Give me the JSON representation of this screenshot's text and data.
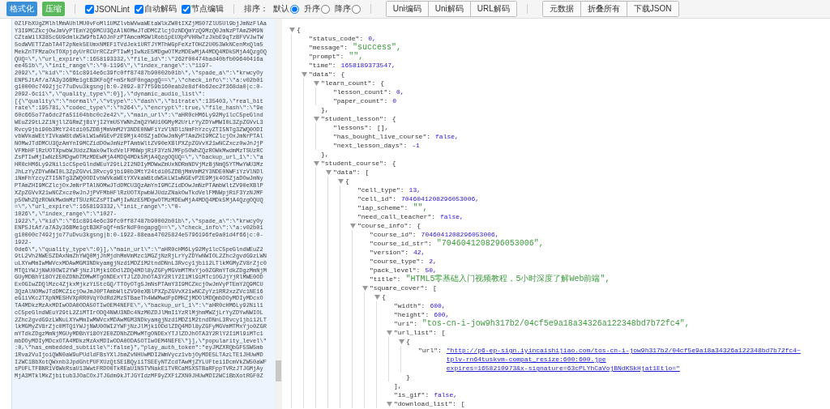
{
  "toolbar": {
    "primary_buttons": [
      {
        "label": "格式化",
        "kind": "blue"
      },
      {
        "label": "压缩",
        "kind": "green"
      }
    ],
    "checkboxes": [
      {
        "label": "JSONLint",
        "checked": true
      },
      {
        "label": "自动解码",
        "checked": true
      },
      {
        "label": "节点编辑",
        "checked": true
      }
    ],
    "sort": {
      "label": "排序：",
      "options": [
        {
          "label": "默认",
          "selected": true
        },
        {
          "label": "升序",
          "selected": false
        },
        {
          "label": "降序",
          "selected": false
        }
      ]
    },
    "button_groups": [
      [
        "Uni编码",
        "Uni解码",
        "URL解码"
      ],
      [
        "元数据",
        "折叠所有",
        "下载JSON"
      ]
    ]
  },
  "input": {
    "text_lines": [
      "0ZlFbXUgZMlhlMmAUhlMU0vFoMl1UMZlvbWVwaWEtaWlkZW0tIXZjMS07ZlU5Ul9bjJmNzFlAa",
      "Y3I9MCZkcjOwJmVyPTEmY2Q9MCU3QzAlNOMwJTdDMCZlcjOzNDQmYzQ9MzQ0JmNzPTAmZHM9N",
      "CZtaW1lX385cGU9dmlkZW9fbIAOJnFzPTAmcmM9WlRob1pEUXpPVHRwTzJkbE9qTzBFVVJwTW",
      "5odWVETTZabTA4T2pNek5EUmxNMEF1TVdJek1URTJYMThWGpFeXzTOHZ2U053WkNCenMxQlm5",
      "MekZnTFMzaOxTOXpjdyUrRCUrRCZzPTIwMjIwNzE5MDgwOTMzMDEwMjA4MDQ4MDk5MjA4QzgOQ",
      "QUQ=\\\",\\\"url_expire\\\":1658193332,\\\"file_id\\\":\\\"262f00474bad40bfb09640416a",
      "ee451b\\\",\\\"init_range\\\":\\\"0-1196\\\",\\\"index_range\\\":\\\"1197-",
      "2092\\\",\\\"kid\\\":\\\"61c8914e6c39fc0ff87487b90002b01b\\\",\\\"spade_a\\\":\\\"krwcyOy",
      "ENP5JtAf/a7A3y36BMe1gtB3KFoQf+mSrNdF0ngapgQ==\\\",\\\"check_info\\\":\\\"a:v02b01",
      "g10000c7492jjc77uDvu3kgsng|b:0-2092-877f59b160eab2e8df4b62ec2f368da0|c:0-",
      "2092-6c11\\\",\\\"quality_type\\\":0}],\\\"dynamic_audio_list\\\":",
      "[{\\\"quality\\\":\\\"normal\\\",\\\"vtype\\\":\\\"dash\\\",\\\"bitrate\\\":135403,\\\"real_bit",
      "rate\\\":195781,\\\"codec_type\\\":\\\"h264\\\",\\\"encrypt\\\":true,\\\"file_hash\\\":\\\"9e",
      "60c665o77a6dc2fa51104bbc0c2e42\\\",\\\"main_url\\\":\\\"aHR0cHM6Ly92My1lcC5peGlnd",
      "WEuZ29tL2Z1NjllZGRmZjBiYjI2YmU5YWNhZmQ2YWU10GMyM2UrLrYyZDYwMWI0L3ZpZGVvL3",
      "Rvcy9jbi90b3MtY24tdi05ZDBjMmVmM2Y3NDE0NWFiYzVlNDliNmFhYzcyZTI5NTg3ZWQ0ODI",
      "vbWVkaWEtYIVkaW8tdW5kLW1wNGEvP2E9Mjk4OSZjaDOwJmNyPTAmZHI9MCZlcjOxJmNrPTAl",
      "NOMwJTdDMCU3QzAmYnI9MCZidDOwJmNzPTAmbWltZV90eXBlPXZpZGVvX21wNCZxcz0wJnJjP",
      "VFMbHFlRzUOTXpwbWJUdzZNak0wTkdVelFMNWpjRiF3YzNJMFp5OWhZQzROWkMwdmMzTSUzRC",
      "ZsPTIwMjIwNzE5MDgwOTMzMDEwMjA4MDQ4MDk5MjA4QzgOQUQ=\\\",\\\"backup_url_1\\\":\\\"a",
      "HR0cHM6Ly92Nil1cC5peGlndWEuY29tL2I2NDIyMDWwZmUxNDRmNDVjMzBjNmQ5YTMwYWU3Mz",
      "JhLzYyZDYwNWI0L3ZpZGVvL3Rvcy9jbi90b3MtY24tdi05ZDBjMmVmM2Y3NDE0NWFiYzVlNDl",
      "iNmFhYzcyZTI5NTg3ZWQ0ODIvbWVkaWEtYXVkaW8tdW5kLW1wNGEvP2E9Mjk4OSZjaDOwJmNy",
      "PTAmZHI9MCZlcjOxJmNrPTAlNOMwJTdDMCU3QzAmYnI9MCZidDOwJmNzPTAmbWltZV90eXBlP",
      "XZpZGVvX21wNCZxcz0wJnJjPVFMbHFlRzUOTXpwbWJUdzZNakOwTkdVelFMNWpjRiF3YzNJMF",
      "p5OWhZQzROWkMwdmMzTSUzRCZsPTIwMjIwNzE5MDgwOTMzMDEwMjA4MDQ4MDk5MjA4QzgOQUQ",
      "=\\\",\\\"url_expire\\\":1658193332,\\\"init_range\\\":\\\"0-",
      "1026\\\",\\\"index_range\\\":\\\"1027-",
      "1922\\\",\\\"kid\\\":\\\"61c8914e6c39fc0ff87487b90002b01b\\\",\\\"spade_a\\\":\\\"krwcyOy",
      "ENP5JtAf/a7A3y36BMe1gtB3KFoQf+mSrNdF0ngapgQ==\\\",\\\"check_info\\\":\\\"a:v02b01",
      "g10000c7492jjo77uDvu3kgsng|b:0-1922-88eaa47025824e5796196fe9a01d4f66|c:0-",
      "1922-",
      "0de6\\\",\\\"quality_type\\\":0}],\\\"main_url\\\":\\\"aHR0cHM6Ly92My1lcC5peGlndWEuZ2",
      "9tL2Vh2NWE5ZDAxNmZhYWQ0MjJhMjdhMmVmMzc1MGZjNzRjLrYyZDYwNWIOL2Zhc2gvdG9zLWN",
      "uLXYwMmIwMWVcxMDAwMGM3NDkyamgjNzd1MDZ1M2tndDNnL3Rvcy1jbi12LTlkMGMyZV8rZjc0",
      "MTQ1YWJjNWU0OWI2YWFjNzJlMjk1ODdlZDQ4MDl8yZGFyMGVmMTMxYjo0ZGRmYTdkZDgzMmNjM",
      "GUyMDBhY18OY2E0ZDNhZDMwMTgONDExYTJlZDJhOTA3Y2RlY2I1Ml9iMTc1OGJjYjRlMWE0OD",
      "ExOGIwZDQlMzc4ZjkxMjkzYi5tcGQ/TTOyOTg5JmNsPTAmY3I9MCZkcjOwJmVyPTEmY2Q9MCU",
      "3QzAlNOMwJTdDMCZicjOwJmJ0PTAmbWltZV90eXBlPXZpZGVvX21wNCZyYz1RR2xzZVc1NE16",
      "eG1iVKc2TXpNMESHVXpRR0VqY0dRd2MzSTBaeTh4WWMwdFpDMHZjMDOlMDQmbDOyMDIyMDcxO",
      "TA4MDkzMzAxMDIwODA0ODA5OTIwOEM4NEFE\\\",\\\"backup_url_1\\\":\\\"aHR0cHM6Ly92Nil1",
      "cC5peGlndWEuY29tL2ZiMTIrODQ4NWU3NDc4NzM0ZDJlMmI1YzRlMjhmMWZjLrYyZDYwNWIOL",
      "2Zhc2gvdG9zLWNuLXYwMmIwMWVcxMDAwMGM3NDkyamgjNzd1MDZ1M2tndDNnL3Rvcy1jbi12LT",
      "lkMGMyZV8rZjc0MTQ1YWJjNWU0OWI2YWFjNzJlMjk1ODdlZDQ4MDl8yZGFyMGVmMTMxYjo0ZGR",
      "mYTdkZDgzMmNjMGUyMDBhY18OY2E0ZDNhZDMwMTgONDExYTJlZDJhOTA3Y2RlY2I1Ml9iMTc1",
      "mbDOyMDIyMDcxOTA4MDkzMzAxMDIwODA0ODA5OTIwOEM4NEFE\\\"}],\\\"popularity_level\\\"",
      ":0,\\\"has_embedded_subtitle\\\":false}\",\"play_auth_token\":\"eyJMZXRQbGF5SW5mb",
      "1Rva2VuIjoiQWN0aW9uPUdldFBsYXlJbmZvNHUwMDI2WmVycz1vbjOyMDE5LTAzLTE1JHUwMD",
      "I2WC1BbXotQWxnb3JpdGhtPUFXUzQtSE1BQyi1TSEEyNTZcdTAwMjZYLUFtei1DcmVkZW50aWF",
      "sPUFLTFBNR1V6WkRsaU13WwtFRDO0TkREaU1NSTVNakE1TVRCaM5XSTBaRFppTVRzJTJGMjAy",
      "MjA3MTklMkZjbitub3JOaCOxJTJGdm9kJTJGYIdzMF9yZXF1ZXN0JHUwMDI2WC1BbXotRGF0Z"
    ]
  },
  "tree": {
    "open": "{",
    "expanded": true,
    "children": [
      {
        "key": "\"status_code\":",
        "value": "0,",
        "kind": "number"
      },
      {
        "key": "\"message\":",
        "value": "\"success\",",
        "kind": "string"
      },
      {
        "key": "\"prompt\":",
        "value": "\"\",",
        "kind": "string"
      },
      {
        "key": "\"time\":",
        "value": "1658189373547,",
        "kind": "number"
      },
      {
        "key": "\"data\":",
        "open": "{",
        "expanded": true,
        "children": [
          {
            "key": "\"learn_count\":",
            "open": "{",
            "expanded": true,
            "close": "},",
            "children": [
              {
                "key": "\"lesson_count\":",
                "value": "0,",
                "kind": "number"
              },
              {
                "key": "\"paper_count\":",
                "value": "0",
                "kind": "number"
              }
            ]
          },
          {
            "key": "\"student_lesson\":",
            "open": "{",
            "expanded": true,
            "close": "},",
            "children": [
              {
                "key": "\"lessons\":",
                "value": "[],",
                "kind": "plain"
              },
              {
                "key": "\"has_bought_live_course\":",
                "value": "false,",
                "kind": "boolean"
              },
              {
                "key": "\"next_lesson_days\":",
                "value": "-1",
                "kind": "number"
              }
            ]
          },
          {
            "key": "\"student_course\":",
            "open": "{",
            "expanded": true,
            "children": [
              {
                "key": "\"data\":",
                "open": "[",
                "expanded": true,
                "children": [
                  {
                    "open": "{",
                    "expanded": true,
                    "children": [
                      {
                        "key": "\"cell_type\":",
                        "value": "13,",
                        "kind": "number"
                      },
                      {
                        "key": "\"cell_id\":",
                        "value": "7046041208296053006,",
                        "kind": "number"
                      },
                      {
                        "key": "\"iap_scheme\":",
                        "value": "\"\",",
                        "kind": "string"
                      },
                      {
                        "key": "\"need_call_teacher\":",
                        "value": "false,",
                        "kind": "boolean"
                      },
                      {
                        "key": "\"course_info\":",
                        "open": "{",
                        "expanded": true,
                        "children": [
                          {
                            "key": "\"course_id\":",
                            "value": "7046041208296053006,",
                            "kind": "number"
                          },
                          {
                            "key": "\"course_id_str\":",
                            "value": "\"7046041208296053006\",",
                            "kind": "string"
                          },
                          {
                            "key": "\"version\":",
                            "value": "42,",
                            "kind": "number"
                          },
                          {
                            "key": "\"course_type\":",
                            "value": "2,",
                            "kind": "number"
                          },
                          {
                            "key": "\"pack_level\":",
                            "value": "50,",
                            "kind": "number"
                          },
                          {
                            "key": "\"title\":",
                            "value": "\"HTML5零基础入门视频教程，5小时深度了解Web前端\",",
                            "kind": "string"
                          },
                          {
                            "key": "\"square_cover\":",
                            "open": "[",
                            "expanded": true,
                            "children": [
                              {
                                "open": "{",
                                "expanded": true,
                                "children": [
                                  {
                                    "key": "\"width\":",
                                    "value": "600,",
                                    "kind": "number"
                                  },
                                  {
                                    "key": "\"height\":",
                                    "value": "600,",
                                    "kind": "number"
                                  },
                                  {
                                    "key": "\"uri\":",
                                    "value": "\"tos-cn-i-jow9h317b2/04cf5e9a18a34326a122348bd7b72fc4\",",
                                    "kind": "string"
                                  },
                                  {
                                    "key": "\"url_list\":",
                                    "open": "[",
                                    "expanded": true,
                                    "close": "],",
                                    "children": [
                                      {
                                        "open": "{",
                                        "expanded": true,
                                        "close": "}",
                                        "children": [
                                          {
                                            "key": "\"url\":",
                                            "value": "\"http://p6-ep-sign.iyincaishijiao.com/tos-cn-i-jow9h317b2/04cf5e9a18a34326a122348bd7b72fc4~tplv-rn64tuskvm-compat_resize:600:600.jpe\nexpires=1658210973&x-signature=63cPLYhCaVojBNdKSkHjat1Etlo=\"",
                                            "kind": "link"
                                          }
                                        ]
                                      }
                                    ]
                                  },
                                  {
                                    "key": "\"is_gif\":",
                                    "value": "false,",
                                    "kind": "boolean"
                                  },
                                  {
                                    "key": "\"download_list\":",
                                    "open": "[",
                                    "expanded": true
                                  }
                                ]
                              }
                            ]
                          }
                        ]
                      }
                    ]
                  }
                ]
              }
            ]
          }
        ]
      }
    ]
  }
}
